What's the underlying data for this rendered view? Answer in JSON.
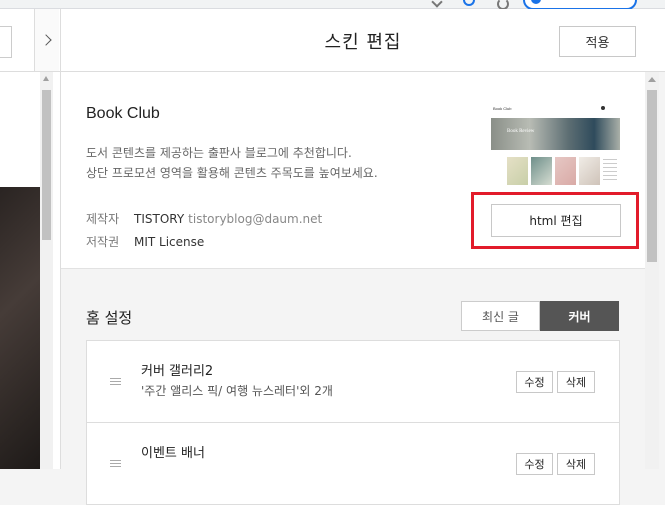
{
  "editor": {
    "title": "스킨 편집",
    "apply_label": "적용"
  },
  "skin": {
    "name": "Book Club",
    "description_line1": "도서 콘텐츠를 제공하는 출판사 블로그에 추천합니다.",
    "description_line2": "상단 프로모션 영역을 활용해 콘텐츠 주목도를 높여보세요.",
    "author_label": "제작자",
    "author_name": "TISTORY",
    "author_email": "tistoryblog@daum.net",
    "license_label": "저작권",
    "license_value": "MIT License",
    "html_edit_label": "html 편집",
    "thumbnail": {
      "title": "Book Club",
      "hero_text": "Book Review"
    },
    "highlight_color": "#e21b2a"
  },
  "home_settings": {
    "title": "홈 설정",
    "tabs": [
      {
        "label": "최신 글",
        "active": false
      },
      {
        "label": "커버",
        "active": true
      }
    ],
    "items": [
      {
        "name": "커버 갤러리2",
        "subtitle": "'주간 앨리스 픽/ 여행 뉴스레터'외 2개",
        "edit_label": "수정",
        "delete_label": "삭제"
      },
      {
        "name": "이벤트 배너",
        "subtitle": "",
        "edit_label": "수정",
        "delete_label": "삭제"
      }
    ]
  },
  "icons": {
    "collapse": "chevron-right-icon",
    "drag": "drag-handle-icon"
  }
}
